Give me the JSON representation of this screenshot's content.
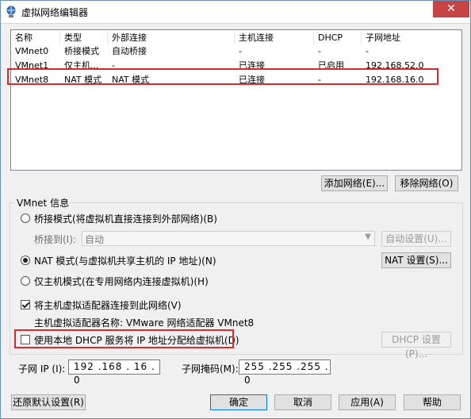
{
  "window": {
    "title": "虚拟网络编辑器",
    "close_glyph": "✕"
  },
  "table": {
    "headers": [
      "名称",
      "类型",
      "外部连接",
      "主机连接",
      "DHCP",
      "子网地址"
    ],
    "rows": [
      [
        "VMnet0",
        "桥接模式",
        "自动桥接",
        "-",
        "-",
        "-"
      ],
      [
        "VMnet1",
        "仅主机...",
        "-",
        "已连接",
        "已启用",
        "192.168.52.0"
      ],
      [
        "VMnet8",
        "NAT 模式",
        "NAT 模式",
        "已连接",
        "-",
        "192.168.16.0"
      ]
    ]
  },
  "list_buttons": {
    "add": "添加网络(E)...",
    "remove": "移除网络(O)"
  },
  "vmnet_info": {
    "group_title": "VMnet 信息",
    "bridged_label": "桥接模式(将虚拟机直接连接到外部网络)(B)",
    "bridge_to_label": "桥接到(I):",
    "bridge_to_value": "自动",
    "auto_settings": "自动设置(U)...",
    "nat_label": "NAT 模式(与虚拟机共享主机的 IP 地址)(N)",
    "nat_settings": "NAT 设置(S)...",
    "hostonly_label": "仅主机模式(在专用网络内连接虚拟机)(H)",
    "connect_adapter_label": "将主机虚拟适配器连接到此网络(V)",
    "adapter_name_label": "主机虚拟适配器名称: VMware 网络适配器 VMnet8",
    "dhcp_label": "使用本地 DHCP 服务将 IP 地址分配给虚拟机(D)",
    "dhcp_settings": "DHCP 设置(P)..."
  },
  "subnet": {
    "ip_label": "子网 IP (I):",
    "ip_value": "192 .168 . 16 . 0",
    "mask_label": "子网掩码(M):",
    "mask_value": "255 .255 .255 . 0"
  },
  "footer": {
    "restore": "还原默认设置(R)",
    "ok": "确定",
    "cancel": "取消",
    "apply": "应用(A)",
    "help": "帮助"
  },
  "state": {
    "selected_network": "VMnet8",
    "mode": "nat",
    "connect_adapter": true,
    "use_dhcp": false
  },
  "colors": {
    "highlight_outline": "#d92b2b",
    "window_border": "#6b8fb5",
    "close_button": "#c74444"
  }
}
